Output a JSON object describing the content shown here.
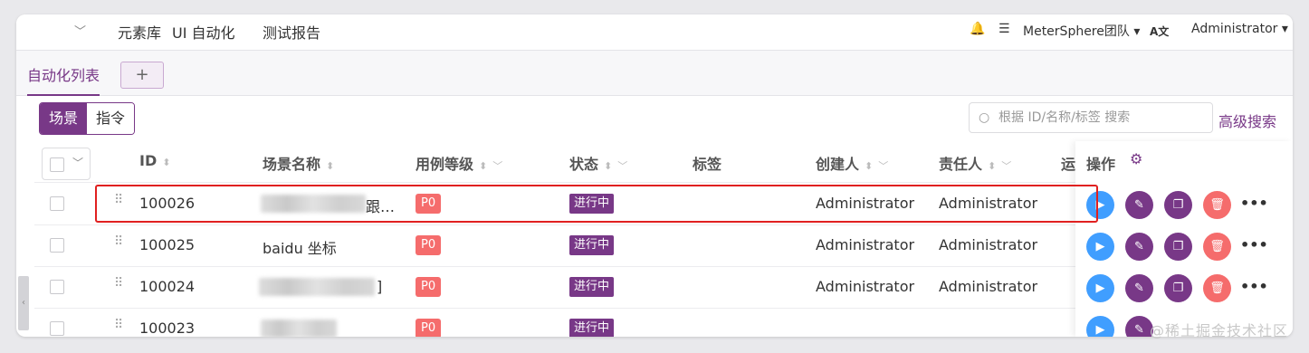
{
  "nav": {
    "tabs": [
      "元素库",
      "UI 自动化",
      "测试报告"
    ],
    "team": "MeterSphere团队",
    "user": "Administrator"
  },
  "subtabs": {
    "active": "自动化列表",
    "add": "+"
  },
  "segment": {
    "scene": "场景",
    "command": "指令"
  },
  "search": {
    "placeholder": "根据 ID/名称/标签 搜索",
    "advanced": "高级搜索"
  },
  "columns": {
    "id": "ID",
    "name": "场景名称",
    "level": "用例等级",
    "status": "状态",
    "tags": "标签",
    "creator": "创建人",
    "owner": "责任人",
    "run": "运",
    "actions": "操作"
  },
  "rows": [
    {
      "id": "100026",
      "name": "跟…",
      "name_blurred": true,
      "level": "P0",
      "status": "进行中",
      "creator": "Administrator",
      "owner": "Administrator"
    },
    {
      "id": "100025",
      "name": "baidu 坐标",
      "name_blurred": false,
      "level": "P0",
      "status": "进行中",
      "creator": "Administrator",
      "owner": "Administrator"
    },
    {
      "id": "100024",
      "name": "]",
      "name_blurred": true,
      "level": "P0",
      "status": "进行中",
      "creator": "Administrator",
      "owner": "Administrator"
    },
    {
      "id": "100023",
      "name": "",
      "name_blurred": true,
      "level": "P0",
      "status": "进行中",
      "creator": "",
      "owner": ""
    }
  ],
  "watermark": "@稀土掘金技术社区",
  "colors": {
    "brand": "#783887",
    "danger": "#f56c6c",
    "primary": "#409eff",
    "highlight": "#e02020"
  }
}
